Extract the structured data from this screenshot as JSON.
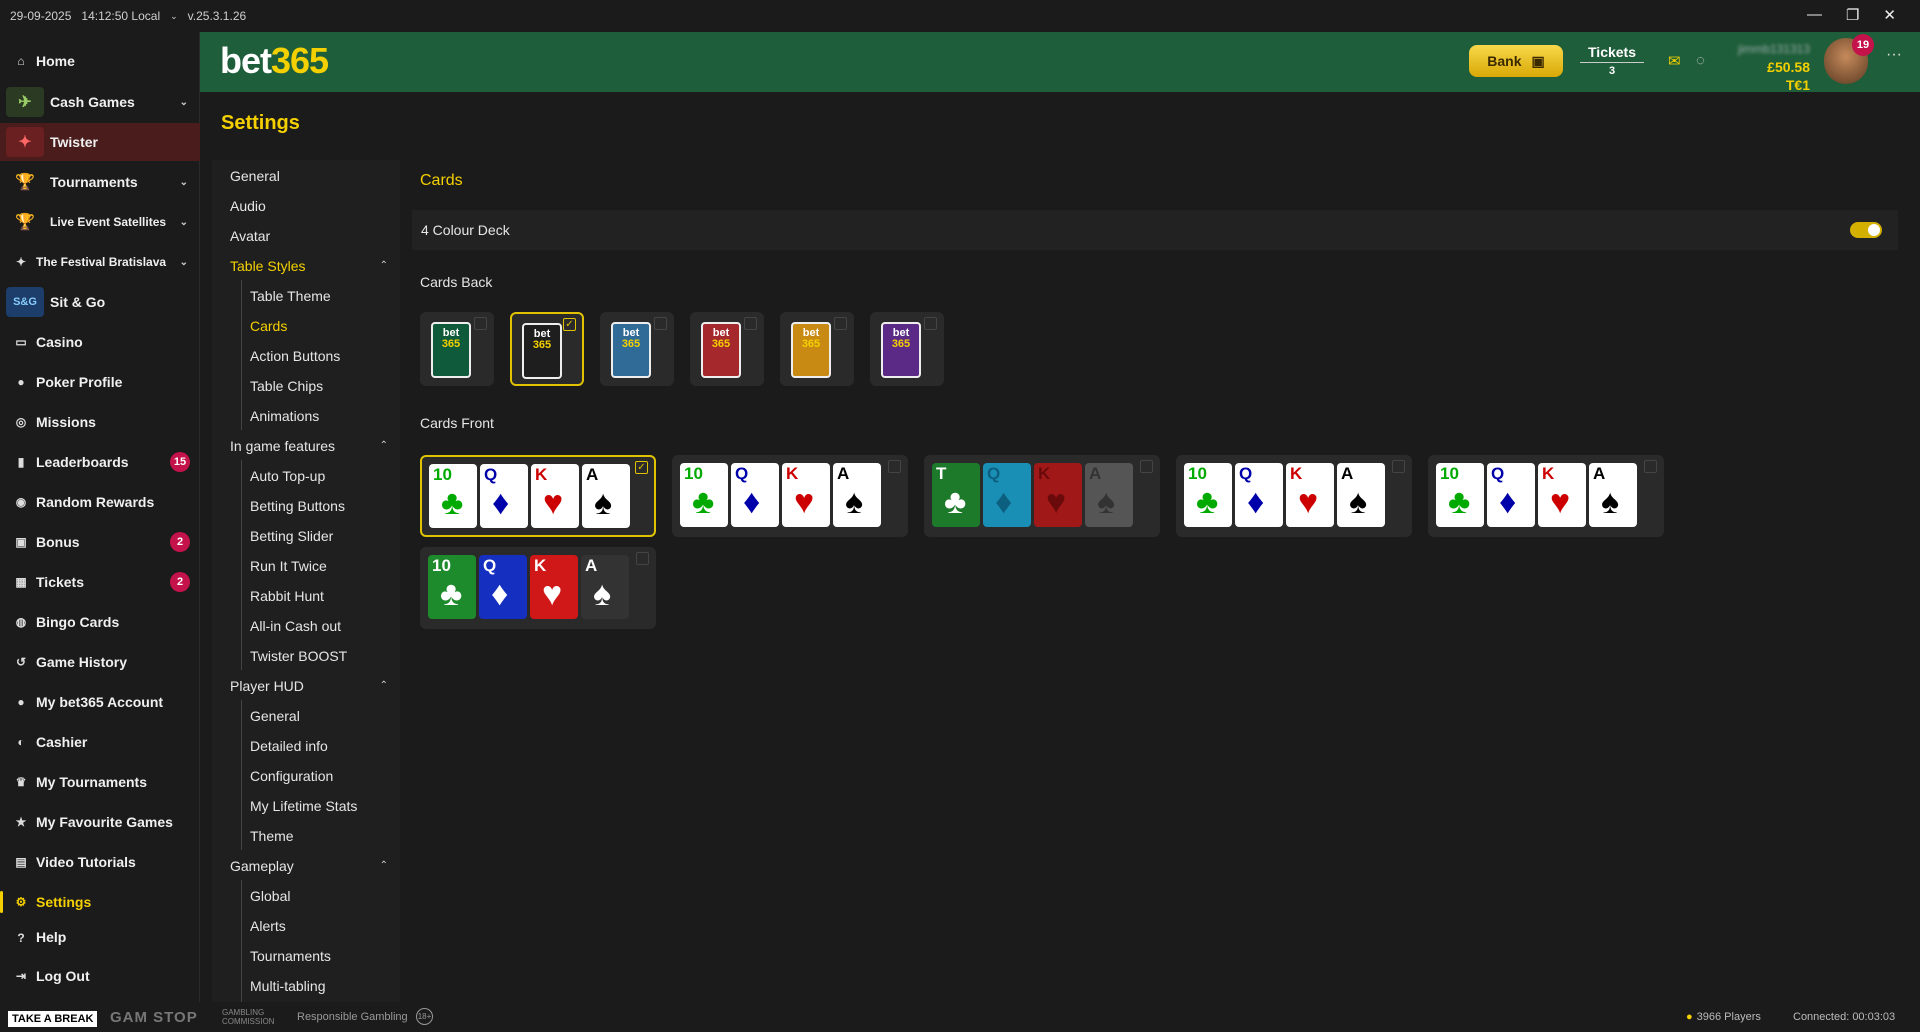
{
  "titlebar": {
    "date": "29-09-2025",
    "time": "14:12:50 Local",
    "version": "v.25.3.1.26"
  },
  "sidebar": {
    "items": [
      {
        "label": "Home",
        "icon": "home-icon"
      },
      {
        "label": "Cash Games",
        "icon": "cash-games-icon"
      },
      {
        "label": "Twister",
        "icon": "twister-icon"
      },
      {
        "label": "Tournaments",
        "icon": "trophy-icon"
      },
      {
        "label": "Live Event Satellites",
        "icon": "trophy-icon"
      },
      {
        "label": "The Festival Bratislava",
        "icon": "sparkle-icon"
      },
      {
        "label": "Sit & Go",
        "icon": "sit-go-icon"
      },
      {
        "label": "Casino",
        "icon": "casino-icon"
      },
      {
        "label": "Poker Profile",
        "icon": "user-icon"
      },
      {
        "label": "Missions",
        "icon": "target-icon"
      },
      {
        "label": "Leaderboards",
        "icon": "bar-chart-icon",
        "badge": "15"
      },
      {
        "label": "Random Rewards",
        "icon": "gift-icon"
      },
      {
        "label": "Bonus",
        "icon": "bag-icon",
        "badge": "2"
      },
      {
        "label": "Tickets",
        "icon": "ticket-icon",
        "badge": "2"
      },
      {
        "label": "Bingo Cards",
        "icon": "bingo-icon"
      },
      {
        "label": "Game History",
        "icon": "history-icon"
      },
      {
        "label": "My bet365 Account",
        "icon": "user-icon"
      },
      {
        "label": "Cashier",
        "icon": "cashier-icon"
      },
      {
        "label": "My Tournaments",
        "icon": "trophy-icon"
      },
      {
        "label": "My Favourite Games",
        "icon": "star-icon"
      },
      {
        "label": "Video Tutorials",
        "icon": "video-icon"
      },
      {
        "label": "Settings",
        "icon": "gear-icon"
      },
      {
        "label": "Help",
        "icon": "help-icon"
      },
      {
        "label": "Log Out",
        "icon": "logout-icon"
      }
    ]
  },
  "header": {
    "logo_b": "bet",
    "logo_n": "365",
    "bank_label": "Bank",
    "tickets_label": "Tickets",
    "tickets_count": "3",
    "username": "jimmb131313",
    "balance": "£50.58",
    "tokens": "T€1",
    "avatar_badge": "19"
  },
  "page": {
    "title": "Settings"
  },
  "settings_nav": {
    "general": "General",
    "audio": "Audio",
    "avatar": "Avatar",
    "table_styles": "Table Styles",
    "table_styles_items": [
      "Table Theme",
      "Cards",
      "Action Buttons",
      "Table Chips",
      "Animations"
    ],
    "in_game": "In game features",
    "in_game_items": [
      "Auto Top-up",
      "Betting Buttons",
      "Betting Slider",
      "Run It Twice",
      "Rabbit Hunt",
      "All-in Cash out",
      "Twister BOOST"
    ],
    "player_hud": "Player HUD",
    "player_hud_items": [
      "General",
      "Detailed info",
      "Configuration",
      "My Lifetime Stats",
      "Theme"
    ],
    "gameplay": "Gameplay",
    "gameplay_items": [
      "Global",
      "Alerts",
      "Tournaments",
      "Multi-tabling"
    ]
  },
  "content": {
    "title": "Cards",
    "four_colour_deck": "4 Colour Deck",
    "four_colour_on": true,
    "cards_back_title": "Cards Back",
    "cards_back_line1": "bet",
    "cards_back_line2": "365",
    "cards_back": [
      {
        "color": "#0f5a3a"
      },
      {
        "color": "#1e1e1e",
        "selected": true
      },
      {
        "color": "#2f6b96"
      },
      {
        "color": "#a5282c"
      },
      {
        "color": "#c88a12"
      },
      {
        "color": "#5b2a86"
      }
    ],
    "cards_front_title": "Cards Front",
    "card_ranks_a": [
      "10",
      "Q",
      "K",
      "A"
    ],
    "card_ranks_b": [
      "T",
      "Q",
      "K",
      "A"
    ],
    "suits": [
      "♣",
      "♦",
      "♥",
      "♠"
    ]
  },
  "footer": {
    "take_a_break": "TAKE A BREAK",
    "gamstop": "GAM STOP",
    "gambling_commission": "GAMBLING COMMISSION",
    "responsible": "Responsible Gambling",
    "age": "18+",
    "players": "3966 Players",
    "connected": "Connected: 00:03:03"
  }
}
